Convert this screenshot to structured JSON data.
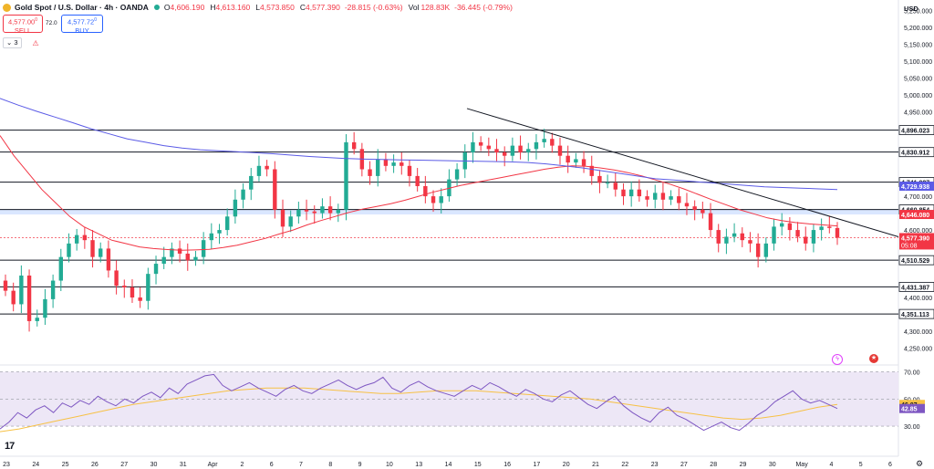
{
  "header": {
    "title": "Gold Spot / U.S. Dollar · 4h · OANDA",
    "open_label": "O",
    "open": "4,606.190",
    "high_label": "H",
    "high": "4,613.160",
    "low_label": "L",
    "low": "4,573.850",
    "close_label": "C",
    "close": "4,577.390",
    "change": "-28.815 (-0.63%)",
    "vol_label": "Vol",
    "vol": "128.83K",
    "vol_change": "-36.445 (-0.79%)"
  },
  "trade": {
    "sell_price": "4,577.00",
    "sell_sup": "0",
    "sell_label": "SELL",
    "spread": "72.0",
    "buy_price": "4,577.72",
    "buy_sup": "0",
    "buy_label": "BUY"
  },
  "indicators_count": "3",
  "currency": "USD",
  "logo_text": "17",
  "colors": {
    "up": "#22ab94",
    "down": "#f23645",
    "ma_fast": "#f23645",
    "ma_slow": "#5b5be6",
    "rsi": "#7e57c2",
    "rsi_ma": "#f7c145",
    "rsi_band": "#ede7f6",
    "level": "#131722",
    "current_price_bg": "#f23645",
    "trend": "#131722"
  },
  "chart_data": {
    "type": "candlestick",
    "symbol": "Gold Spot / U.S. Dollar",
    "timeframe": "4h",
    "y_ticks": [
      "5,250.000",
      "5,200.000",
      "5,150.000",
      "5,100.000",
      "5,050.000",
      "5,000.000",
      "4,950.000",
      "4,700.000",
      "4,600.000",
      "4,400.000",
      "4,300.000",
      "4,250.000"
    ],
    "x_ticks": [
      "23",
      "24",
      "25",
      "26",
      "27",
      "30",
      "31",
      "Apr",
      "2",
      "6",
      "7",
      "8",
      "9",
      "10",
      "13",
      "14",
      "15",
      "16",
      "17",
      "20",
      "21",
      "22",
      "23",
      "27",
      "28",
      "29",
      "30",
      "May",
      "4",
      "5",
      "6"
    ],
    "ylim": [
      4200,
      5260
    ],
    "horizontal_levels": [
      {
        "value": 4896.023,
        "label": "4,896.023"
      },
      {
        "value": 4830.912,
        "label": "4,830.912"
      },
      {
        "value": 4741.927,
        "label": "4,741.927"
      },
      {
        "value": 4660.854,
        "label": "4,660.854"
      },
      {
        "value": 4510.529,
        "label": "4,510.529"
      },
      {
        "value": 4431.387,
        "label": "4,431.387"
      },
      {
        "value": 4351.113,
        "label": "4,351.113"
      }
    ],
    "badges": [
      {
        "value": 4729.938,
        "label": "4,729.938",
        "color": "#5b5be6"
      },
      {
        "value": 4646.08,
        "label": "4,646.080",
        "color": "#f23645"
      },
      {
        "value": 4577.39,
        "label": "4,577.390",
        "sub": "05:08",
        "color": "#f23645"
      }
    ],
    "resistance_zone": [
      4646.08,
      4660.854
    ],
    "closes": [
      4420,
      4380,
      4465,
      4330,
      4340,
      4395,
      4450,
      4520,
      4560,
      4585,
      4570,
      4520,
      4545,
      4480,
      4435,
      4430,
      4400,
      4390,
      4470,
      4500,
      4520,
      4545,
      4530,
      4510,
      4520,
      4570,
      4590,
      4600,
      4640,
      4690,
      4720,
      4760,
      4790,
      4780,
      4660,
      4610,
      4640,
      4660,
      4655,
      4650,
      4670,
      4650,
      4660,
      4860,
      4840,
      4780,
      4760,
      4810,
      4790,
      4800,
      4790,
      4760,
      4730,
      4700,
      4680,
      4700,
      4750,
      4780,
      4830,
      4860,
      4850,
      4840,
      4830,
      4820,
      4850,
      4830,
      4840,
      4860,
      4870,
      4850,
      4820,
      4800,
      4810,
      4790,
      4760,
      4740,
      4740,
      4720,
      4700,
      4720,
      4700,
      4690,
      4710,
      4690,
      4700,
      4680,
      4670,
      4660,
      4650,
      4600,
      4560,
      4580,
      4590,
      4570,
      4560,
      4520,
      4560,
      4610,
      4620,
      4600,
      4580,
      4560,
      4600,
      4610,
      4606,
      4577
    ],
    "ma_fast_values": [
      4880,
      4820,
      4770,
      4720,
      4680,
      4640,
      4610,
      4590,
      4570,
      4560,
      4550,
      4545,
      4542,
      4540,
      4541,
      4543,
      4548,
      4555,
      4565,
      4575,
      4588,
      4600,
      4615,
      4628,
      4640,
      4652,
      4662,
      4670,
      4678,
      4688,
      4700,
      4712,
      4722,
      4732,
      4740,
      4748,
      4756,
      4764,
      4772,
      4780,
      4786,
      4790,
      4789,
      4784,
      4778,
      4770,
      4760,
      4748,
      4736,
      4722,
      4706,
      4690,
      4675,
      4660,
      4648,
      4636,
      4628,
      4622,
      4618,
      4615,
      4612
    ],
    "ma_slow_values": [
      4990,
      4970,
      4952,
      4935,
      4918,
      4900,
      4885,
      4870,
      4860,
      4850,
      4843,
      4838,
      4835,
      4832,
      4829,
      4826,
      4822,
      4818,
      4815,
      4812,
      4810,
      4809,
      4808,
      4807,
      4806,
      4805,
      4804,
      4803,
      4802,
      4800,
      4796,
      4790,
      4784,
      4776,
      4768,
      4760,
      4752,
      4748,
      4744,
      4740,
      4736,
      4732,
      4728,
      4726,
      4724,
      4722,
      4720
    ],
    "trendline": [
      {
        "x_index": 0,
        "value": 4960
      },
      {
        "x_index": 1,
        "value": 4580
      }
    ],
    "rsi": {
      "ylim": [
        20,
        75
      ],
      "ticks": [
        "70.00",
        "50.00",
        "30.00"
      ],
      "bands": [
        70,
        50,
        30
      ],
      "rsi_label": "42.85",
      "rsi_ma_label": "46.07",
      "values": [
        28,
        33,
        40,
        36,
        42,
        45,
        40,
        47,
        44,
        49,
        46,
        52,
        48,
        45,
        50,
        47,
        52,
        55,
        51,
        58,
        54,
        61,
        64,
        67,
        68,
        60,
        56,
        59,
        62,
        58,
        55,
        52,
        57,
        60,
        56,
        54,
        58,
        61,
        64,
        60,
        57,
        60,
        62,
        66,
        58,
        55,
        60,
        63,
        59,
        56,
        54,
        52,
        56,
        60,
        57,
        62,
        59,
        55,
        52,
        57,
        54,
        50,
        48,
        53,
        56,
        51,
        46,
        43,
        48,
        52,
        45,
        40,
        36,
        33,
        40,
        44,
        38,
        35,
        31,
        27,
        30,
        33,
        29,
        27,
        32,
        38,
        42,
        48,
        52,
        56,
        50,
        47,
        49,
        46,
        43
      ],
      "ma_values": [
        26,
        28,
        31,
        34,
        37,
        40,
        43,
        46,
        48,
        50,
        52,
        54,
        56,
        57,
        58,
        58,
        58,
        57,
        56,
        55,
        54,
        54,
        55,
        56,
        56,
        56,
        55,
        54,
        53,
        52,
        51,
        50,
        48,
        46,
        44,
        42,
        40,
        38,
        36,
        35,
        36,
        38,
        41,
        44,
        46
      ]
    }
  }
}
